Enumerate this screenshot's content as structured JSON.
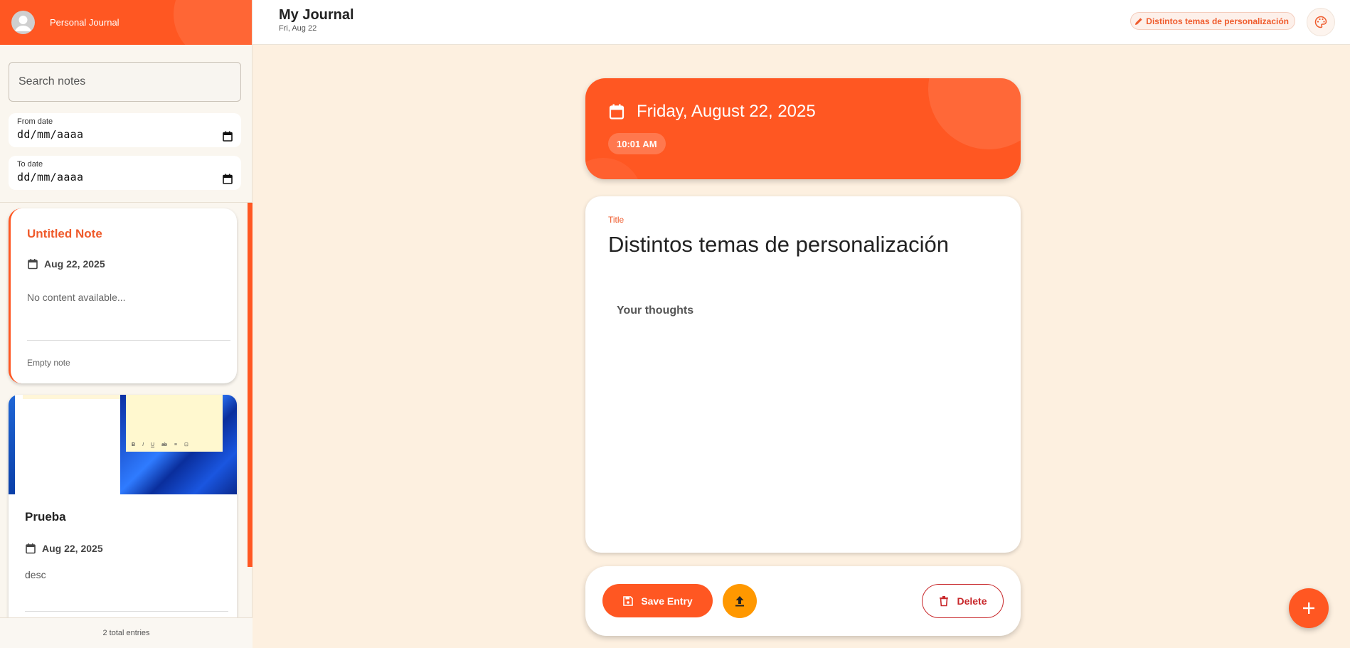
{
  "sidebar": {
    "title": "Personal Journal",
    "search_placeholder": "Search notes",
    "from_date": {
      "label": "From date",
      "value": "dd/mm/aaaa"
    },
    "to_date": {
      "label": "To date",
      "value": "dd/mm/aaaa"
    },
    "notes": [
      {
        "title": "Untitled Note",
        "date": "Aug 22, 2025",
        "content": "No content available...",
        "footer": "Empty note"
      },
      {
        "title": "Prueba",
        "date": "Aug 22, 2025",
        "content": "desc",
        "thumb_tools": [
          "B",
          "I",
          "U",
          "ab",
          "≡",
          "⊡"
        ]
      }
    ],
    "footer": "2 total entries"
  },
  "topbar": {
    "title": "My Journal",
    "date": "Fri, Aug 22",
    "current_note_chip": "Distintos temas de personalización",
    "palette_icon": "palette-icon"
  },
  "editor": {
    "date_heading": "Friday, August 22, 2025",
    "time": "10:01 AM",
    "title_label": "Title",
    "title_value": "Distintos temas de personalización",
    "body_placeholder": "Your thoughts"
  },
  "actions": {
    "save_label": "Save Entry",
    "delete_label": "Delete"
  },
  "colors": {
    "accent": "#ff5722",
    "upload": "#ff9800",
    "danger": "#c8282b",
    "background": "#fdf0e0"
  }
}
